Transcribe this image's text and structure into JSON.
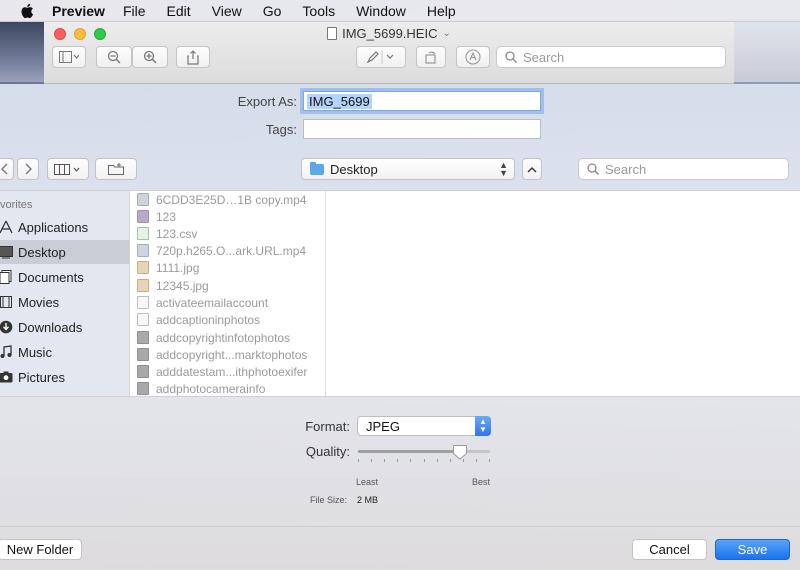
{
  "menubar": {
    "app_name": "Preview",
    "items": [
      "File",
      "Edit",
      "View",
      "Go",
      "Tools",
      "Window",
      "Help"
    ]
  },
  "window": {
    "title": "IMG_5699.HEIC",
    "search_placeholder": "Search",
    "toolbar_icons": [
      "sidebar-toggle-icon",
      "zoom-out-icon",
      "zoom-in-icon",
      "share-icon",
      "markup-pen-icon",
      "rotate-icon",
      "annotate-icon",
      "search-icon"
    ]
  },
  "sheet": {
    "export_as_label": "Export As:",
    "export_as_value": "IMG_5699",
    "tags_label": "Tags:",
    "tags_value": "",
    "location": "Desktop",
    "search_placeholder": "Search",
    "sidebar": {
      "section": "vorites",
      "items": [
        {
          "label": "Applications",
          "icon": "applications-icon"
        },
        {
          "label": "Desktop",
          "icon": "desktop-icon",
          "active": true
        },
        {
          "label": "Documents",
          "icon": "documents-icon"
        },
        {
          "label": "Movies",
          "icon": "movies-icon"
        },
        {
          "label": "Downloads",
          "icon": "downloads-icon"
        },
        {
          "label": "Music",
          "icon": "music-icon"
        },
        {
          "label": "Pictures",
          "icon": "pictures-icon"
        }
      ]
    },
    "files": [
      {
        "name": "6CDD3E25D…1B copy.mp4",
        "kind": "video"
      },
      {
        "name": "123",
        "kind": "img"
      },
      {
        "name": "123.csv",
        "kind": "csv"
      },
      {
        "name": "720p.h265.O...ark.URL.mp4",
        "kind": "video"
      },
      {
        "name": "1111.jpg",
        "kind": "jpg"
      },
      {
        "name": "12345.jpg",
        "kind": "jpg"
      },
      {
        "name": "activateemailaccount",
        "kind": "doc"
      },
      {
        "name": "addcaptioninphotos",
        "kind": "doc"
      },
      {
        "name": "addcopyrightinfotophotos",
        "kind": "photo"
      },
      {
        "name": "addcopyright...marktophotos",
        "kind": "photo"
      },
      {
        "name": "adddatestam...ithphotoexifer",
        "kind": "photo"
      },
      {
        "name": "addphotocamerainfo",
        "kind": "photo"
      }
    ],
    "format_label": "Format:",
    "format_value": "JPEG",
    "quality_label": "Quality:",
    "quality_level": 0.77,
    "quality_min_label": "Least",
    "quality_max_label": "Best",
    "file_size_label": "File Size:",
    "file_size_value": "2 MB",
    "new_folder_label": "New Folder",
    "cancel_label": "Cancel",
    "save_label": "Save"
  },
  "colors": {
    "accent": "#1b72ec",
    "sidebar_selection": "#c9cdd5"
  }
}
